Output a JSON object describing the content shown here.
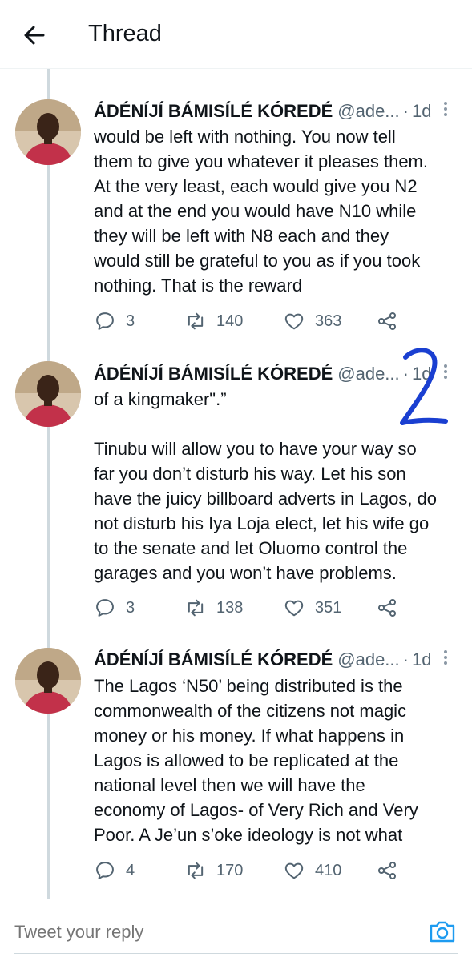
{
  "header": {
    "title": "Thread"
  },
  "tweets": [
    {
      "author": "ÁDÉNÍJÍ BÁMISÍLÉ KÓREDÉ",
      "handle": "@ade...",
      "separator": "·",
      "time": "1d",
      "text": "would be left with nothing. You now tell\nthem to give you whatever it pleases them.\nAt the very least, each would give you N2\nand at the end you would have N10 while\nthey will be left with N8 each and they\nwould still be grateful to you as if you took\nnothing. That is the reward",
      "replies": "3",
      "retweets": "140",
      "likes": "363"
    },
    {
      "author": "ÁDÉNÍJÍ BÁMISÍLÉ KÓREDÉ",
      "handle": "@ade...",
      "separator": "·",
      "time": "1d",
      "text": "of a kingmaker\".”\n\nTinubu will allow you to have your way so\nfar you don’t disturb his way. Let his son\nhave the juicy billboard adverts in Lagos, do\nnot disturb his Iya Loja elect, let his wife go\nto the senate and let Oluomo control the\ngarages and you won’t have problems.",
      "replies": "3",
      "retweets": "138",
      "likes": "351"
    },
    {
      "author": "ÁDÉNÍJÍ BÁMISÍLÉ KÓREDÉ",
      "handle": "@ade...",
      "separator": "·",
      "time": "1d",
      "text": "The Lagos ‘N50’ being distributed is the\ncommonwealth of the citizens not magic\nmoney or his money. If what happens in\nLagos is allowed to be replicated at the\nnational level then we will have the\neconomy of Lagos- of Very Rich and Very\nPoor. A Je’un s’oke ideology is not what",
      "replies": "4",
      "retweets": "170",
      "likes": "410"
    }
  ],
  "annotation": {
    "text": "2",
    "color": "#1a3fd1"
  },
  "composer": {
    "placeholder": "Tweet your reply"
  },
  "colors": {
    "accent": "#1d9bf0",
    "text": "#0f1419",
    "secondary": "#536471",
    "line": "#cfd9de"
  },
  "icons": {
    "back": "arrow-left-icon",
    "more": "more-vertical-icon",
    "reply": "comment-icon",
    "retweet": "retweet-icon",
    "like": "heart-icon",
    "share": "share-icon",
    "camera": "camera-icon"
  }
}
